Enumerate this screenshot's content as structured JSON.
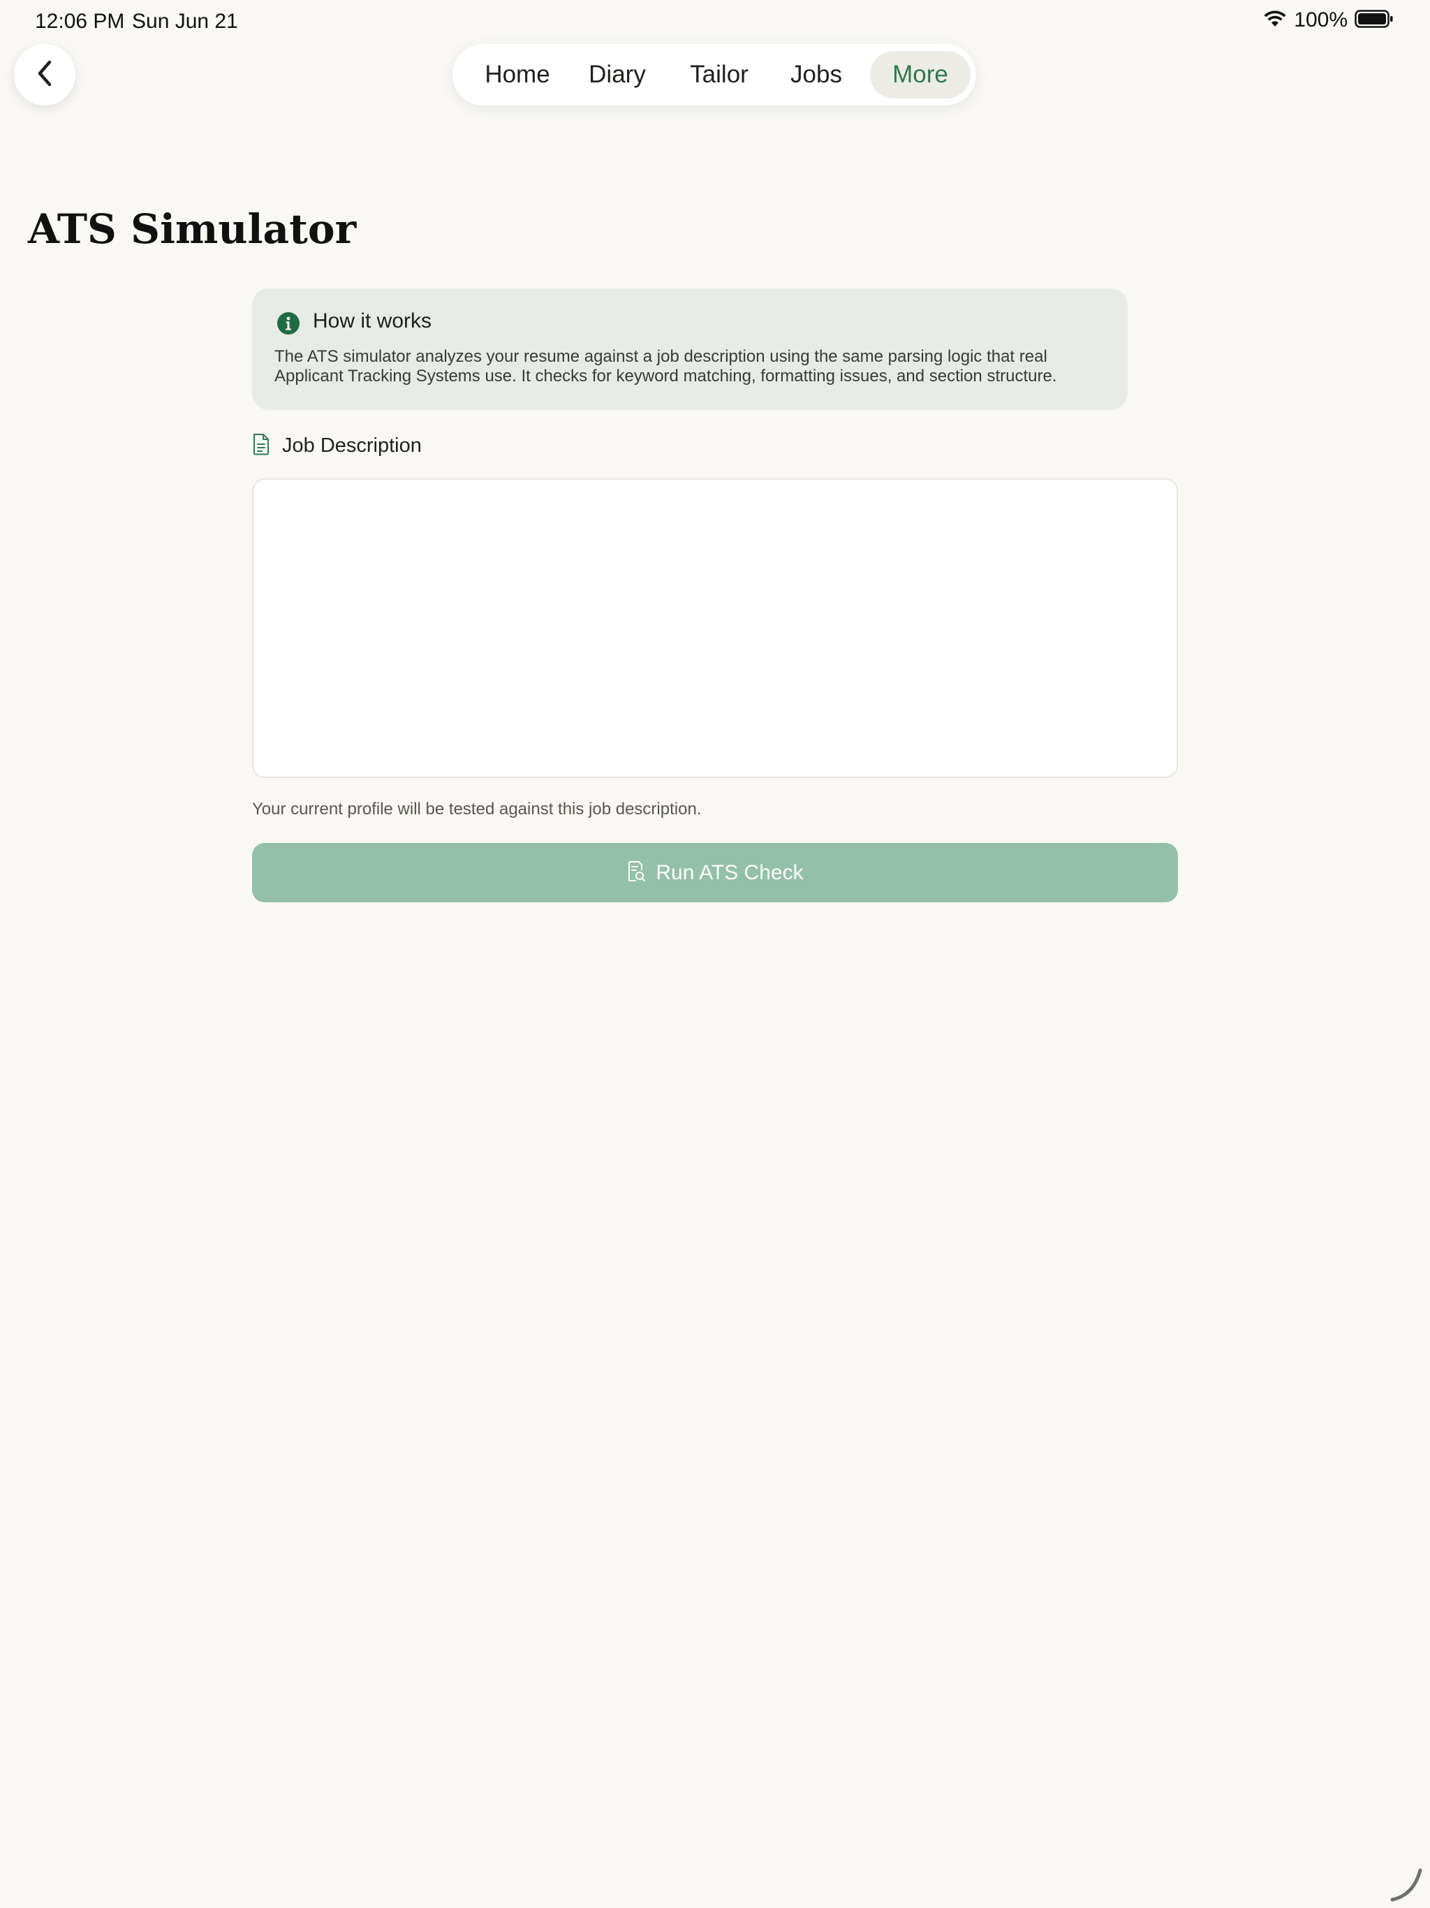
{
  "status_bar": {
    "time": "12:06 PM",
    "date": "Sun Jun 21",
    "battery": "100%"
  },
  "nav": {
    "back_icon": "chevron-left-icon",
    "tabs": [
      {
        "label": "Home",
        "active": false
      },
      {
        "label": "Diary",
        "active": false
      },
      {
        "label": "Tailor",
        "active": false
      },
      {
        "label": "Jobs",
        "active": false
      },
      {
        "label": "More",
        "active": true
      }
    ]
  },
  "page": {
    "title": "ATS Simulator"
  },
  "info_card": {
    "icon": "info-icon",
    "title": "How it works",
    "text": "The ATS simulator analyzes your resume against a job description using the same parsing logic that real Applicant Tracking Systems use. It checks for keyword matching, formatting issues, and section structure."
  },
  "job_description": {
    "icon": "document-icon",
    "label": "Job Description",
    "value": "",
    "helper": "Your current profile will be tested against this job description."
  },
  "run_button": {
    "icon": "document-search-icon",
    "label": "Run ATS Check"
  },
  "colors": {
    "background": "#f9f8f5",
    "accent": "#2e7a4f",
    "info_card_bg": "#e6ebe5",
    "button_disabled": "#93c0a8"
  }
}
